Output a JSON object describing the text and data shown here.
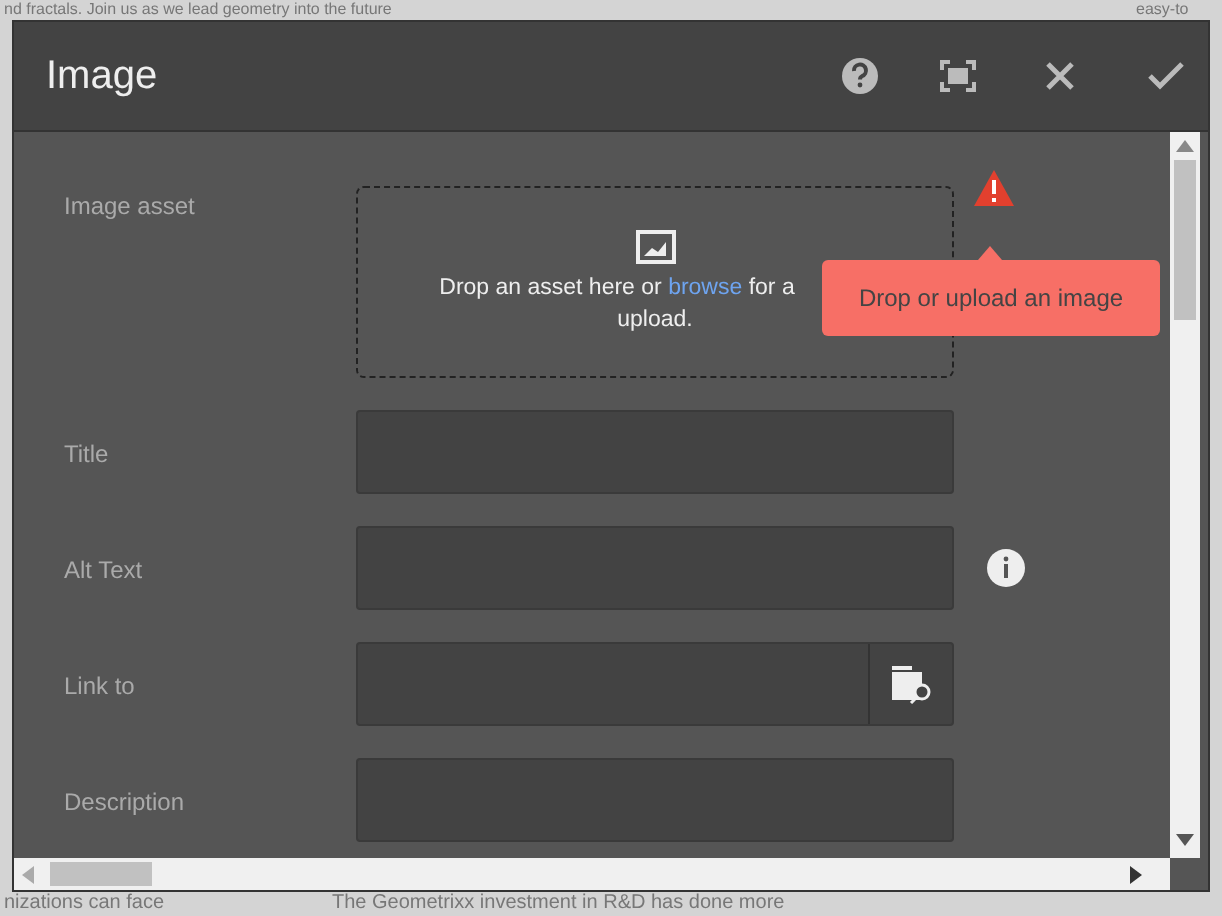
{
  "background_page": {
    "top_text": "nd fractals. Join us as we lead geometry into the future",
    "top_right_text": "easy-to",
    "bottom_left_text": "nizations can face",
    "bottom_text": "The Geometrixx investment in R&D has done more"
  },
  "dialog": {
    "title": "Image"
  },
  "fields": [
    {
      "kind": "dropzone",
      "label": "Image asset",
      "text_before": "Drop an asset here or ",
      "link": "browse",
      "text_after": " for a",
      "second_line": "upload.",
      "error": "Drop or upload an image"
    },
    {
      "kind": "text",
      "label": "Title"
    },
    {
      "kind": "text",
      "label": "Alt Text",
      "info": true
    },
    {
      "kind": "picker",
      "label": "Link to"
    },
    {
      "kind": "text",
      "label": "Description"
    }
  ]
}
